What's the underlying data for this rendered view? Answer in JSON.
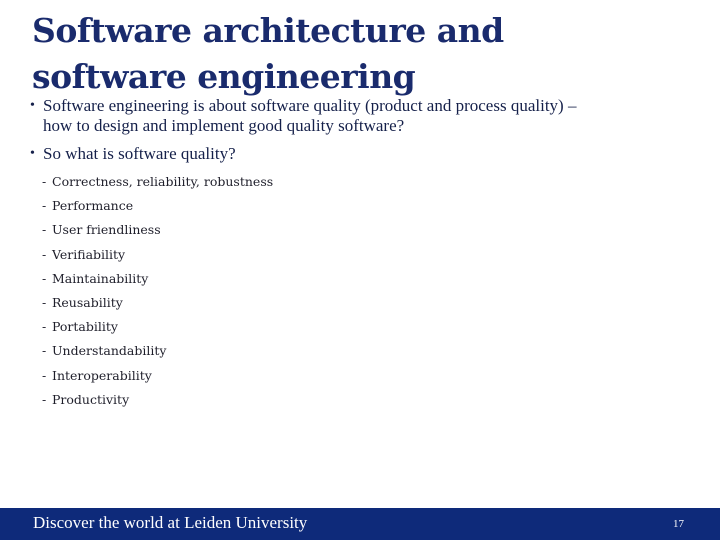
{
  "slide": {
    "title_line1": "Software architecture and",
    "title_line2": "software engineering",
    "bullets": [
      {
        "marker": "•",
        "line1": "Software engineering is about software quality (product and process quality) –",
        "line2": "how to design and implement good quality software?"
      },
      {
        "marker": "•",
        "line1": "So what is software quality?"
      }
    ],
    "quality_attributes": [
      "Correctness, reliability, robustness",
      "Performance",
      "User friendliness",
      "Verifiability",
      "Maintainability",
      "Reusability",
      "Portability",
      "Understandability",
      "Interoperability",
      "Productivity"
    ],
    "dash": "-"
  },
  "footer": {
    "tagline": "Discover the world at Leiden University",
    "page_number": "17"
  },
  "colors": {
    "title": "#1a2b6d",
    "footer_band": "#0e2a7a",
    "footer_text": "#ffffff"
  }
}
